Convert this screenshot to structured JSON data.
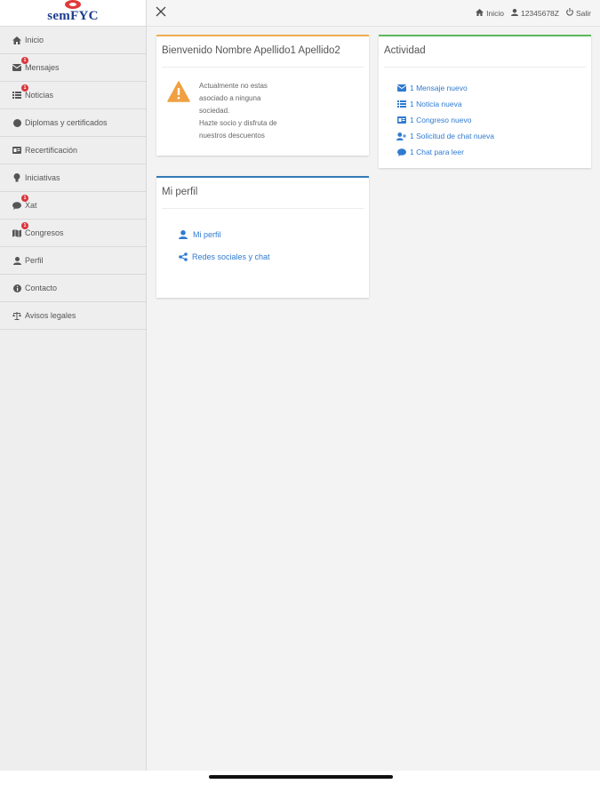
{
  "brand": {
    "logo_text": "semFYC"
  },
  "sidebar": {
    "items": [
      {
        "label": "Inicio",
        "icon": "home-icon",
        "badge": ""
      },
      {
        "label": "Mensajes",
        "icon": "envelope-icon",
        "badge": "1"
      },
      {
        "label": "Noticias",
        "icon": "list-icon",
        "badge": "1"
      },
      {
        "label": "Diplomas y certificados",
        "icon": "certificate-icon",
        "badge": ""
      },
      {
        "label": "Recertificación",
        "icon": "id-card-icon",
        "badge": ""
      },
      {
        "label": "Iniciativas",
        "icon": "lightbulb-icon",
        "badge": ""
      },
      {
        "label": "Xat",
        "icon": "chat-bubble-icon",
        "badge": "1"
      },
      {
        "label": "Congresos",
        "icon": "map-icon",
        "badge": "1"
      },
      {
        "label": "Perfil",
        "icon": "user-icon",
        "badge": ""
      },
      {
        "label": "Contacto",
        "icon": "info-icon",
        "badge": ""
      },
      {
        "label": "Avisos legales",
        "icon": "scale-icon",
        "badge": ""
      }
    ]
  },
  "topbar": {
    "home_label": "Inicio",
    "user_label": "12345678Z",
    "logout_label": "Salir"
  },
  "welcome": {
    "title": "Bienvenido Nombre Apellido1 Apellido2",
    "lines": [
      "Actualmente no estas",
      "asociado a ninguna",
      "sociedad.",
      "Hazte socio y disfruta de",
      "nuestros descuentos"
    ]
  },
  "activity": {
    "title": "Actividad",
    "items": [
      {
        "label": "1 Mensaje nuevo",
        "icon": "envelope-icon"
      },
      {
        "label": "1 Noticia nueva",
        "icon": "list-icon"
      },
      {
        "label": "1 Congreso nuevo",
        "icon": "id-card-icon"
      },
      {
        "label": "1 Solicitud de chat nueva",
        "icon": "user-plus-icon"
      },
      {
        "label": "1 Chat para leer",
        "icon": "chat-bubble-icon"
      }
    ]
  },
  "profile": {
    "title": "Mi perfil",
    "items": [
      {
        "label": "Mi perfil",
        "icon": "user-icon"
      },
      {
        "label": "Redes sociales y chat",
        "icon": "share-icon"
      }
    ]
  },
  "colors": {
    "welcome_accent": "#f0ad4e",
    "activity_accent": "#5cb85c",
    "profile_accent": "#337ab7",
    "link": "#2f7bd1",
    "badge": "#d9363e",
    "warning": "#f0a040"
  }
}
